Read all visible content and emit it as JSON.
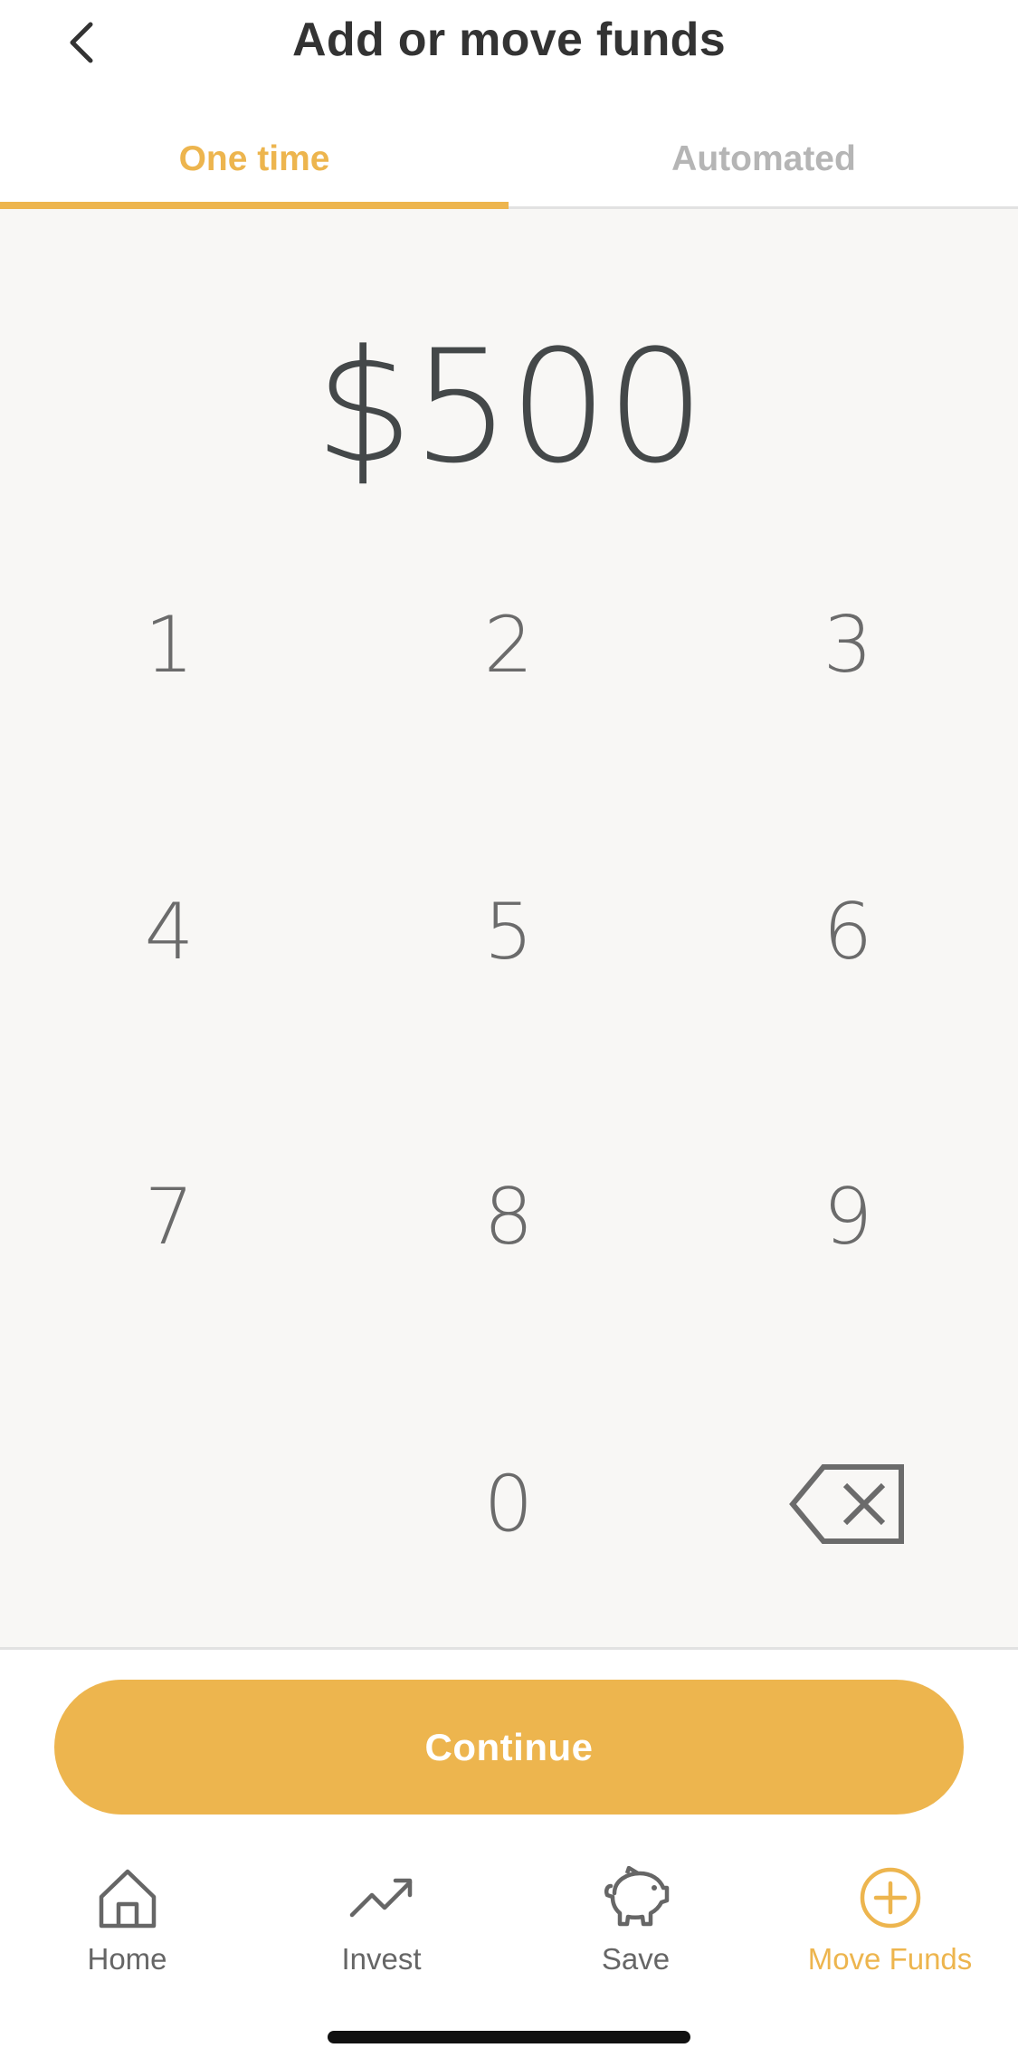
{
  "header": {
    "title": "Add or move funds",
    "back_icon": "chevron-left-icon"
  },
  "tabs": [
    {
      "label": "One time",
      "active": true
    },
    {
      "label": "Automated",
      "active": false
    }
  ],
  "amount": {
    "display": "$500"
  },
  "keypad": {
    "keys": [
      "1",
      "2",
      "3",
      "4",
      "5",
      "6",
      "7",
      "8",
      "9",
      "0"
    ],
    "backspace_icon": "backspace-icon"
  },
  "continue_button": {
    "label": "Continue"
  },
  "nav": {
    "items": [
      {
        "label": "Home",
        "icon": "home-icon",
        "active": false
      },
      {
        "label": "Invest",
        "icon": "trend-up-icon",
        "active": false
      },
      {
        "label": "Save",
        "icon": "piggy-bank-icon",
        "active": false
      },
      {
        "label": "Move Funds",
        "icon": "plus-circle-icon",
        "active": true
      }
    ]
  },
  "colors": {
    "accent": "#EDB54E",
    "keypad_background": "#f8f7f5",
    "text_dark": "#333333",
    "text_muted": "#b5b5b5"
  }
}
